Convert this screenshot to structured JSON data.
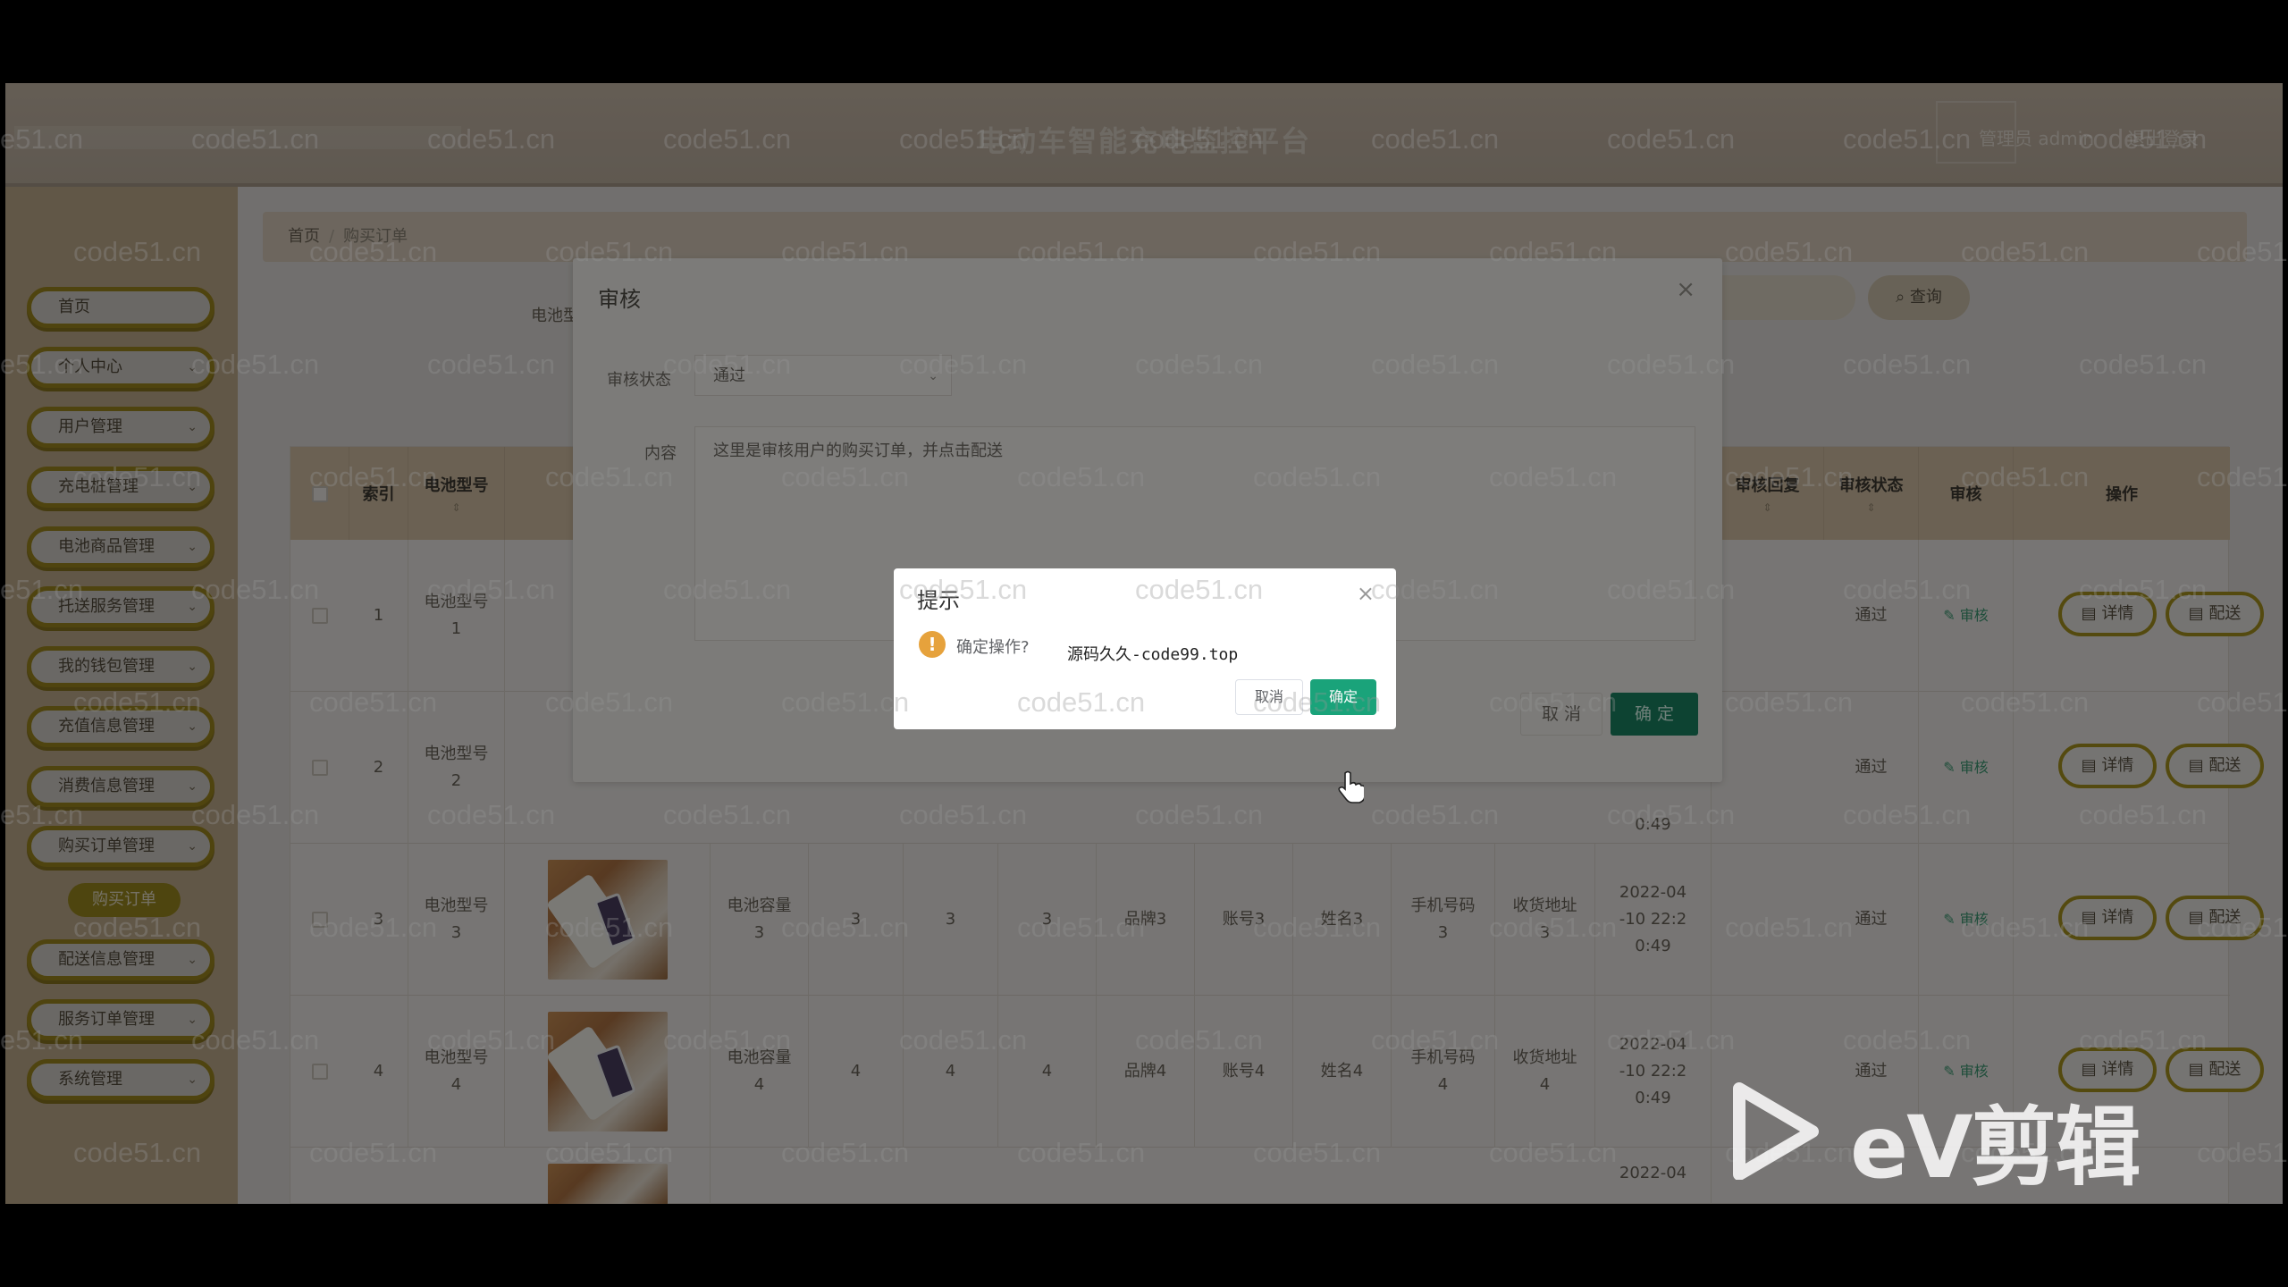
{
  "header": {
    "title": "电动车智能充电监控平台",
    "user": "管理员 admin",
    "logout": "退出登录"
  },
  "sidebar": {
    "items": [
      {
        "label": "首页"
      },
      {
        "label": "个人中心"
      },
      {
        "label": "用户管理"
      },
      {
        "label": "充电桩管理"
      },
      {
        "label": "电池商品管理"
      },
      {
        "label": "托送服务管理"
      },
      {
        "label": "我的钱包管理"
      },
      {
        "label": "充值信息管理"
      },
      {
        "label": "消费信息管理"
      },
      {
        "label": "购买订单管理"
      },
      {
        "label": "配送信息管理"
      },
      {
        "label": "服务订单管理"
      },
      {
        "label": "系统管理"
      }
    ],
    "sub_item": "购买订单"
  },
  "breadcrumb": {
    "home": "首页",
    "sep": "/",
    "current": "购买订单"
  },
  "search": {
    "label": "电池型",
    "placeholder": "审核",
    "button": "查询",
    "icon": "search-icon"
  },
  "table": {
    "headers": {
      "index": "索引",
      "model": "电池型号",
      "reply": "审核回复",
      "status": "审核状态",
      "audit": "审核",
      "ops": "操作"
    },
    "rows": [
      {
        "index": "1",
        "model": "电池型号\n1",
        "status": "通过",
        "audit": "审核",
        "detail": "详情",
        "deliver": "配送"
      },
      {
        "index": "2",
        "model": "电池型号\n2",
        "status": "通过",
        "audit": "审核",
        "detail": "详情",
        "deliver": "配送",
        "time_tail": "0:49"
      },
      {
        "index": "3",
        "model": "电池型号\n3",
        "capacity": "电池容量\n3",
        "c1": "3",
        "c2": "3",
        "c3": "3",
        "brand": "品牌3",
        "account": "账号3",
        "name": "姓名3",
        "phone": "手机号码\n3",
        "address": "收货地址\n3",
        "time": "2022-04\n-10 22:2\n0:49",
        "status": "通过",
        "audit": "审核",
        "detail": "详情",
        "deliver": "配送"
      },
      {
        "index": "4",
        "model": "电池型号\n4",
        "capacity": "电池容量\n4",
        "c1": "4",
        "c2": "4",
        "c3": "4",
        "brand": "品牌4",
        "account": "账号4",
        "name": "姓名4",
        "phone": "手机号码\n4",
        "address": "收货地址\n4",
        "time": "2022-04\n-10 22:2\n0:49",
        "status": "通过",
        "audit": "审核",
        "detail": "详情",
        "deliver": "配送"
      },
      {
        "time": "2022-04"
      }
    ]
  },
  "audit_dialog": {
    "title": "审核",
    "status_label": "审核状态",
    "status_value": "通过",
    "content_label": "内容",
    "content_value": "这里是审核用户的购买订单，并点击配送",
    "cancel": "取 消",
    "ok": "确 定"
  },
  "confirm_dialog": {
    "title": "提示",
    "message": "确定操作?",
    "overlay_text": "源码久久-code99.top",
    "cancel": "取消",
    "ok": "确定"
  },
  "watermark": "code51.cn",
  "logo": {
    "text": "eV剪辑"
  },
  "colors": {
    "accent_gold": "#a8931f",
    "confirm_green": "#1aa37a",
    "audit_green": "#197a5b",
    "warning": "#e6a23c"
  }
}
